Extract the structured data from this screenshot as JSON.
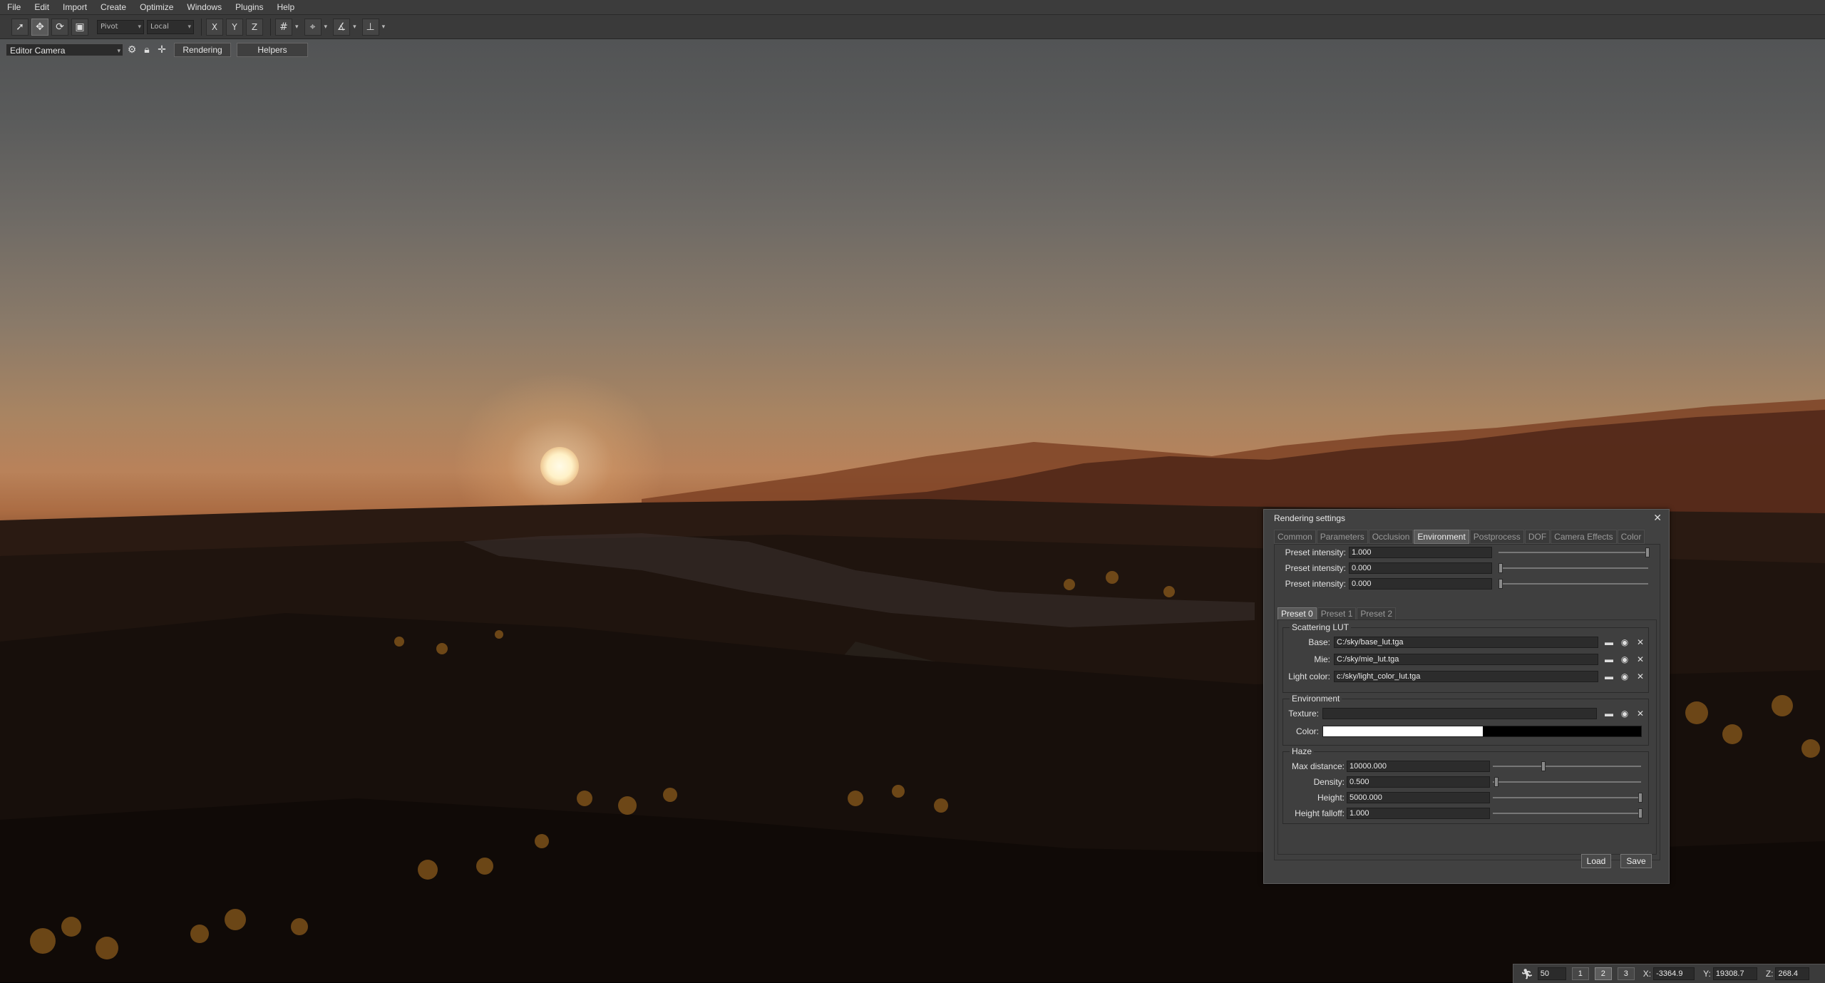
{
  "menubar": {
    "items": [
      "File",
      "Edit",
      "Import",
      "Create",
      "Optimize",
      "Windows",
      "Plugins",
      "Help"
    ]
  },
  "toolbar": {
    "pivot": "Pivot",
    "space": "Local",
    "axis_x": "X",
    "axis_y": "Y",
    "axis_z": "Z"
  },
  "camerabar": {
    "camera": "Editor Camera",
    "rendering_button": "Rendering",
    "helpers_button": "Helpers"
  },
  "dialog": {
    "title": "Rendering settings",
    "tabs": [
      "Common",
      "Parameters",
      "Occlusion",
      "Environment",
      "Postprocess",
      "DOF",
      "Camera Effects",
      "Color"
    ],
    "active_tab": "Environment",
    "preset_intensity_label": "Preset intensity:",
    "preset_intensities": [
      "1.000",
      "0.000",
      "0.000"
    ],
    "preset_tabs": [
      "Preset 0",
      "Preset 1",
      "Preset 2"
    ],
    "scattering": {
      "title": "Scattering LUT",
      "base_label": "Base:",
      "base_value": "C:/sky/base_lut.tga",
      "mie_label": "Mie:",
      "mie_value": "C:/sky/mie_lut.tga",
      "light_label": "Light color:",
      "light_value": "c:/sky/light_color_lut.tga"
    },
    "environment": {
      "title": "Environment",
      "texture_label": "Texture:",
      "texture_value": "",
      "color_label": "Color:"
    },
    "haze": {
      "title": "Haze",
      "max_distance_label": "Max distance:",
      "max_distance": "10000.000",
      "density_label": "Density:",
      "density": "0.500",
      "height_label": "Height:",
      "height": "5000.000",
      "falloff_label": "Height falloff:",
      "falloff": "1.000"
    },
    "load_button": "Load",
    "save_button": "Save"
  },
  "statusbar": {
    "speed": "50",
    "slots": [
      "1",
      "2",
      "3"
    ],
    "x_label": "X:",
    "x_value": "-3364.9",
    "y_label": "Y:",
    "y_value": "19308.7",
    "z_label": "Z:",
    "z_value": "268.4"
  }
}
